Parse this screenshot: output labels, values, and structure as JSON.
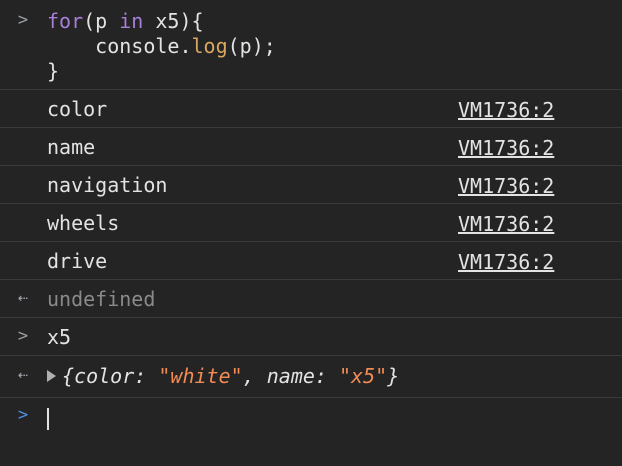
{
  "input_block": {
    "line1_kw": "for",
    "line1_rest_a": "(p ",
    "line1_in": "in",
    "line1_rest_b": " x5){",
    "line2_indent": "    ",
    "line2_obj": "console.",
    "line2_fn": "log",
    "line2_rest": "(p);",
    "line3": "}"
  },
  "log_rows": [
    {
      "text": "color",
      "source": "VM1736:2"
    },
    {
      "text": "name",
      "source": "VM1736:2"
    },
    {
      "text": "navigation",
      "source": "VM1736:2"
    },
    {
      "text": "wheels",
      "source": "VM1736:2"
    },
    {
      "text": "drive",
      "source": "VM1736:2"
    }
  ],
  "return_value": "undefined",
  "second_input": "x5",
  "object_preview": {
    "open": "{",
    "key1": "color",
    "sep1": ": ",
    "val1": "\"white\"",
    "comma": ", ",
    "key2": "name",
    "sep2": ": ",
    "val2": "\"x5\"",
    "close": "}"
  },
  "icons": {
    "input": "chevron-right-icon",
    "output": "return-arrow-icon",
    "expand": "triangle-right-icon"
  },
  "colors": {
    "background": "#242424",
    "keyword": "#a77fd8",
    "function": "#d8a860",
    "string": "#f28b54",
    "active_prompt": "#4f8ff0"
  }
}
